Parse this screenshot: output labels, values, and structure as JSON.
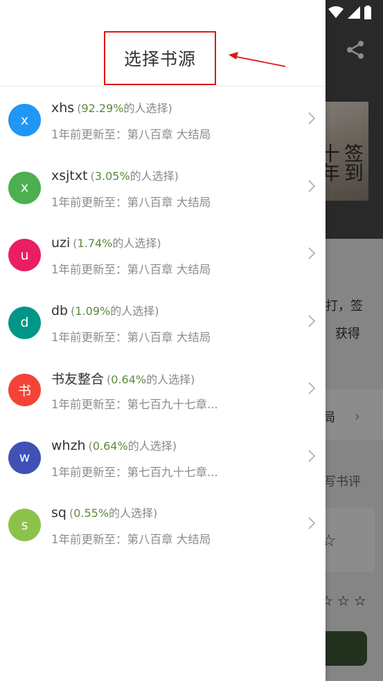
{
  "drawer": {
    "title": "选择书源",
    "sources": [
      {
        "avatar_letter": "x",
        "avatar_color": "#2196f3",
        "name": "xhs",
        "pct": "92.29%",
        "pct_suffix": "的人选择)",
        "update": "1年前更新至：第八百章 大结局"
      },
      {
        "avatar_letter": "x",
        "avatar_color": "#4caf50",
        "name": "xsjtxt",
        "pct": "3.05%",
        "pct_suffix": "的人选择)",
        "update": "1年前更新至：第八百章 大结局"
      },
      {
        "avatar_letter": "u",
        "avatar_color": "#e91e63",
        "name": "uzi",
        "pct": "1.74%",
        "pct_suffix": "的人选择)",
        "update": "1年前更新至：第八百章 大结局"
      },
      {
        "avatar_letter": "d",
        "avatar_color": "#009688",
        "name": "db",
        "pct": "1.09%",
        "pct_suffix": "的人选择)",
        "update": "1年前更新至：第八百章 大结局"
      },
      {
        "avatar_letter": "书",
        "avatar_color": "#f44336",
        "name": "书友整合",
        "pct": "0.64%",
        "pct_suffix": "的人选择)",
        "update": "1年前更新至：第七百九十七章..."
      },
      {
        "avatar_letter": "w",
        "avatar_color": "#3f51b5",
        "name": "whzh",
        "pct": "0.64%",
        "pct_suffix": "的人选择)",
        "update": "1年前更新至：第七百九十七章..."
      },
      {
        "avatar_letter": "s",
        "avatar_color": "#8bc34a",
        "name": "sq",
        "pct": "0.55%",
        "pct_suffix": "的人选择)",
        "update": "1年前更新至：第八百章 大结局"
      }
    ]
  },
  "background": {
    "cover_title": "签到十年",
    "intro_line1": "打，签",
    "intro_line2": "获得",
    "row_text": "局",
    "review_text": "写书评"
  },
  "colors": {
    "accent_green": "#5b8a3a",
    "annotation_red": "#e01515",
    "button_green": "#3f5a36"
  }
}
